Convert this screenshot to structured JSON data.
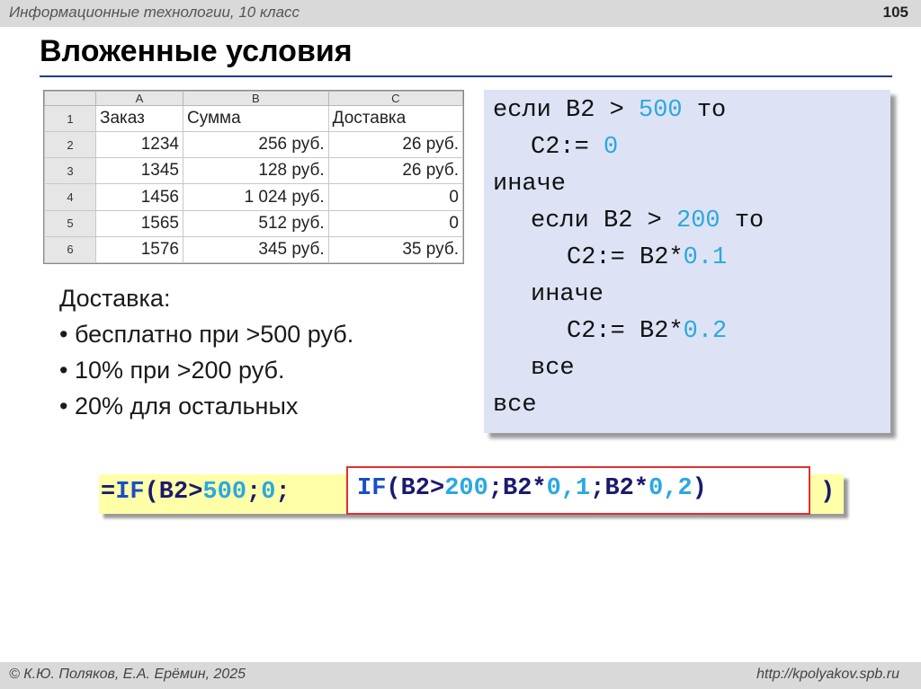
{
  "header": {
    "course": "Информационные технологии, 10 класс",
    "page_number": "105"
  },
  "title": "Вложенные условия",
  "sheet": {
    "columns": [
      "A",
      "B",
      "C"
    ],
    "rows": [
      {
        "num": "1",
        "a": "Заказ",
        "b": "Сумма",
        "c": "Доставка"
      },
      {
        "num": "2",
        "a": "1234",
        "b": "256 руб.",
        "c": "26 руб."
      },
      {
        "num": "3",
        "a": "1345",
        "b": "128 руб.",
        "c": "26 руб."
      },
      {
        "num": "4",
        "a": "1456",
        "b": "1 024 руб.",
        "c": "0"
      },
      {
        "num": "5",
        "a": "1565",
        "b": "512 руб.",
        "c": "0"
      },
      {
        "num": "6",
        "a": "1576",
        "b": "345 руб.",
        "c": "35 руб."
      }
    ]
  },
  "notes": {
    "heading": "Доставка:",
    "items": [
      "• бесплатно при >500 руб.",
      "• 10% при >200 руб.",
      "• 20% для остальных"
    ]
  },
  "code": {
    "l1a": "если B2 > ",
    "l1n": "500",
    "l1b": " то",
    "l2a": "C2:= ",
    "l2n": "0",
    "l3": "иначе",
    "l4a": "если B2 > ",
    "l4n": "200",
    "l4b": " то",
    "l5a": "C2:= B2*",
    "l5n": "0.1",
    "l6": "иначе",
    "l7a": "C2:= B2*",
    "l7n": "0.2",
    "l8": "все",
    "l9": "все"
  },
  "formula": {
    "p1": "=",
    "p2": "IF",
    "p3": "(B2>",
    "p4": "500",
    "p5": ";",
    "p6": "0",
    "p7": ";",
    "q1": "IF",
    "q2": "(B2>",
    "q3": "200",
    "q4": ";B2*",
    "q5": "0,1",
    "q6": ";B2*",
    "q7": "0,2",
    "q8": ")",
    "close": ")"
  },
  "footer": {
    "copyright": "© К.Ю. Поляков, Е.А. Ерёмин, 2025",
    "url": "http://kpolyakov.spb.ru"
  }
}
